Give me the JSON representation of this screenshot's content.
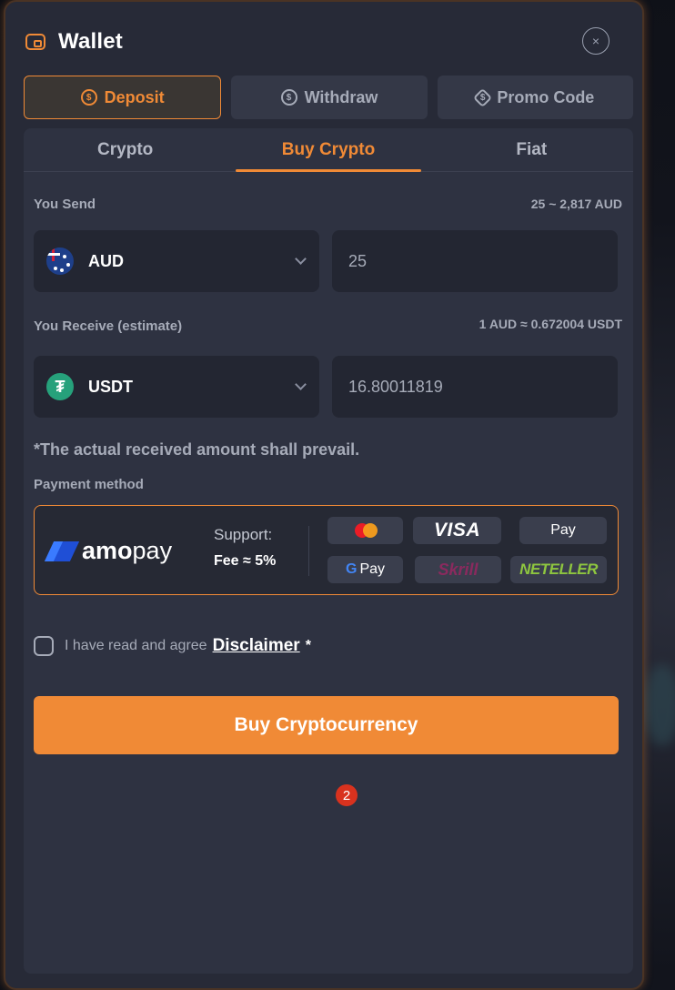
{
  "header": {
    "title": "Wallet",
    "close_label": "×"
  },
  "top_tabs": [
    {
      "label": "Deposit",
      "icon": "$",
      "active": true
    },
    {
      "label": "Withdraw",
      "icon": "$",
      "active": false
    },
    {
      "label": "Promo Code",
      "icon": "$",
      "active": false
    }
  ],
  "sub_tabs": [
    {
      "label": "Crypto",
      "active": false
    },
    {
      "label": "Buy Crypto",
      "active": true
    },
    {
      "label": "Fiat",
      "active": false
    }
  ],
  "send": {
    "label": "You Send",
    "range": "25 ~ 2,817 AUD",
    "currency": "AUD",
    "amount": "25"
  },
  "receive": {
    "label": "You Receive (estimate)",
    "rate": "1 AUD ≈ 0.672004 USDT",
    "currency": "USDT",
    "amount": "16.80011819",
    "currency_icon_glyph": "₮"
  },
  "note": "*The actual received amount shall prevail.",
  "payment": {
    "label": "Payment method",
    "provider_bold": "amo",
    "provider_rest": "pay",
    "support_label": "Support:",
    "fee": "Fee ≈ 5%",
    "methods": {
      "visa": "VISA",
      "apple_pay": "Pay",
      "apple_glyph": "",
      "google_g": "G",
      "google_pay": "Pay",
      "skrill": "Skrill",
      "neteller": "NETELLER"
    }
  },
  "agree": {
    "text": "I have read and agree",
    "link": "Disclaimer",
    "required": "*"
  },
  "buy_button": "Buy Cryptocurrency",
  "notification_count": "2",
  "colors": {
    "accent": "#f08a36",
    "modal_bg": "#272a37",
    "panel_bg": "#2e3241",
    "input_bg": "#232632",
    "tether": "#26a17b",
    "badge": "#d8321e"
  }
}
